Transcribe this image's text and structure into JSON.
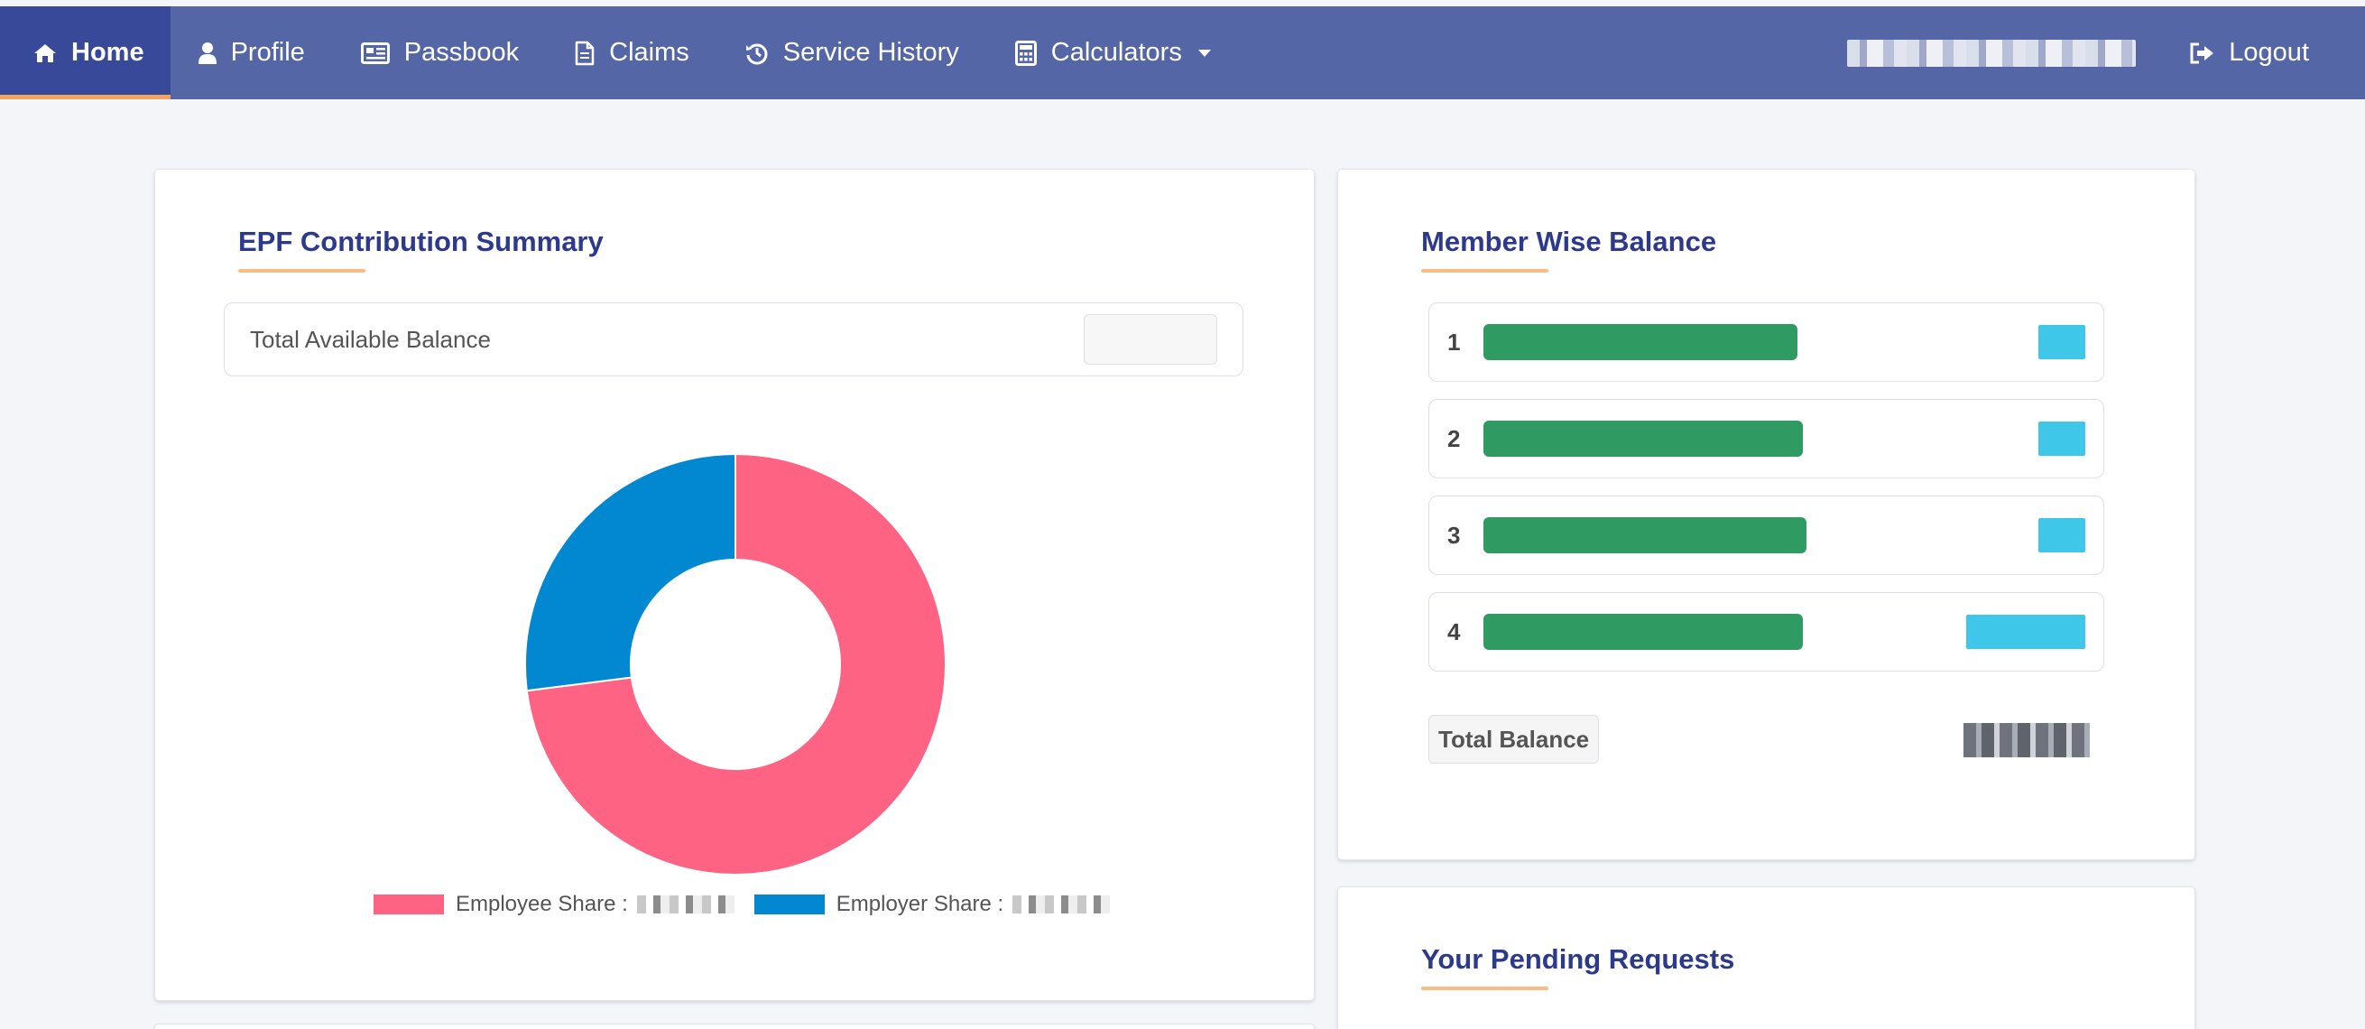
{
  "nav": {
    "items": [
      {
        "label": "Home",
        "icon": "home-icon",
        "active": true
      },
      {
        "label": "Profile",
        "icon": "user-icon"
      },
      {
        "label": "Passbook",
        "icon": "passbook-icon"
      },
      {
        "label": "Claims",
        "icon": "document-icon"
      },
      {
        "label": "Service History",
        "icon": "history-icon"
      },
      {
        "label": "Calculators",
        "icon": "calculator-icon",
        "dropdown": true
      }
    ],
    "logout_label": "Logout",
    "logout_icon": "logout-icon"
  },
  "epf_summary": {
    "title": "EPF Contribution Summary",
    "balance_label": "Total Available Balance",
    "balance_value": "",
    "chart_data": {
      "type": "pie",
      "donut": true,
      "categories": [
        "Employee Share",
        "Employer Share"
      ],
      "values": [
        73,
        27
      ],
      "colors": [
        "#ff6384",
        "#0288d1"
      ],
      "legend": "bottom"
    },
    "legend": [
      {
        "label": "Employee Share :",
        "value": ""
      },
      {
        "label": "Employer Share :",
        "value": ""
      }
    ]
  },
  "member_balance": {
    "title": "Member Wise Balance",
    "members": [
      {
        "index": "1",
        "name": "",
        "balance": ""
      },
      {
        "index": "2",
        "name": "",
        "balance": ""
      },
      {
        "index": "3",
        "name": "",
        "balance": ""
      },
      {
        "index": "4",
        "name": "",
        "balance": ""
      }
    ],
    "total_label": "Total Balance",
    "total_value": ""
  },
  "pending": {
    "title": "Your Pending Requests"
  },
  "colors": {
    "nav_bg": "#5466a6",
    "nav_active": "#39499a",
    "accent": "#f4a35c",
    "title": "#2d3a8c",
    "member_name_bg": "#2f9a61",
    "member_balance_bg": "#3fc7ea"
  }
}
